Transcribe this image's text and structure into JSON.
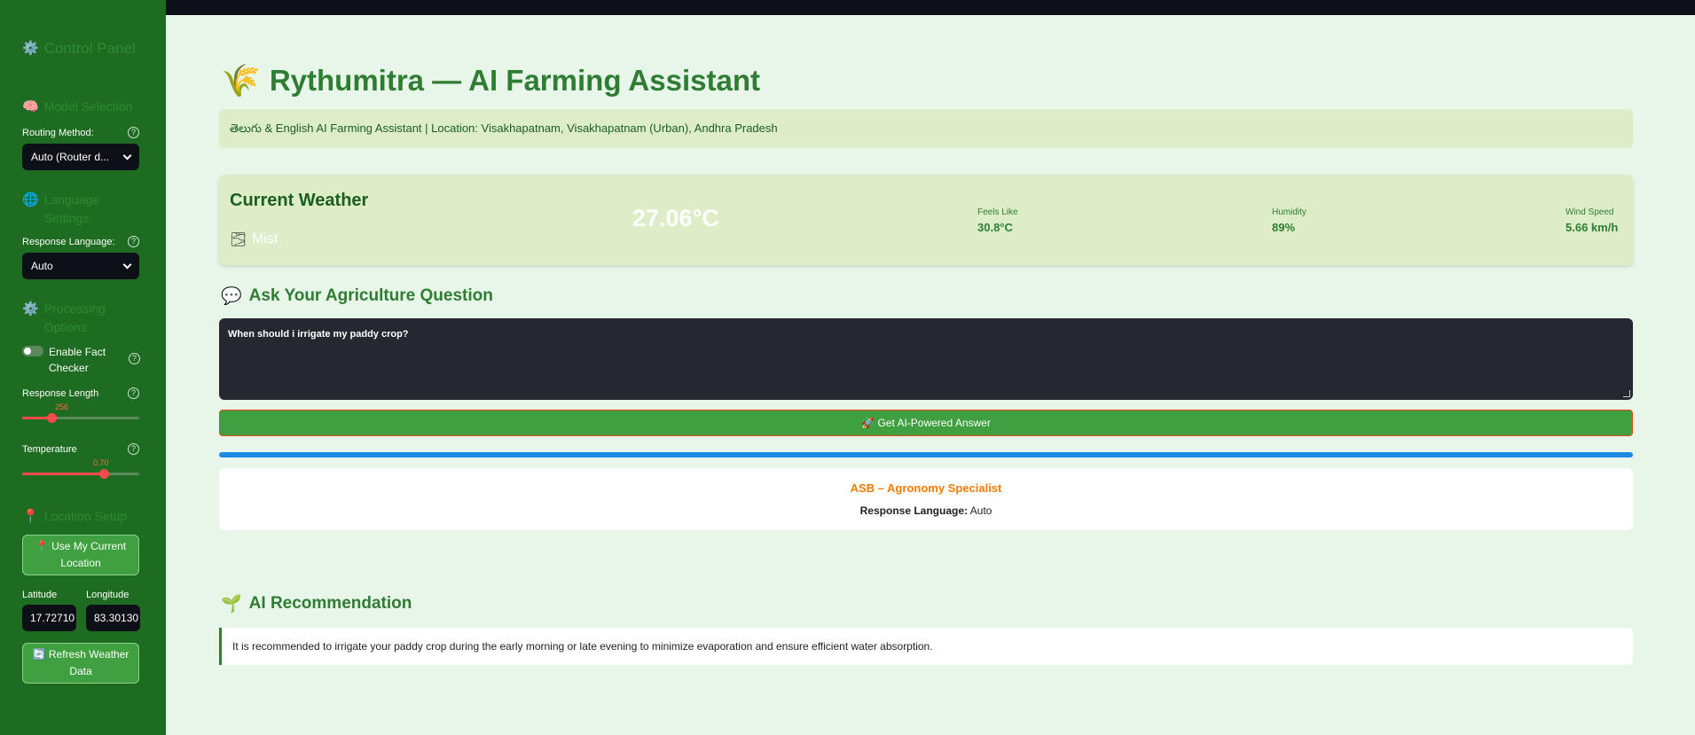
{
  "sidebar": {
    "control_panel": {
      "icon": "⚙️",
      "title": "Control Panel"
    },
    "model_selection": {
      "icon": "🧠",
      "title": "Model Selection"
    },
    "routing_method": {
      "label": "Routing Method:",
      "value": "Auto (Router d..."
    },
    "language_settings": {
      "icon": "🌐",
      "title": "Language Settings"
    },
    "response_language": {
      "label": "Response Language:",
      "value": "Auto"
    },
    "processing_options": {
      "icon": "⚙️",
      "title": "Processing Options"
    },
    "fact_checker": {
      "label": "Enable Fact Checker",
      "enabled": false
    },
    "response_length": {
      "label": "Response Length",
      "value": "256",
      "min": 0,
      "max": 1024
    },
    "temperature": {
      "label": "Temperature",
      "value": "0.70",
      "min": 0,
      "max": 1
    },
    "location_setup": {
      "icon": "📍",
      "title": "Location Setup"
    },
    "use_location_button": {
      "icon": "📍",
      "label": "Use My Current Location"
    },
    "latitude": {
      "label": "Latitude",
      "value": "17.72710"
    },
    "longitude": {
      "label": "Longitude",
      "value": "83.30130"
    },
    "refresh_button": {
      "icon": "🔄",
      "label": "Refresh Weather Data"
    }
  },
  "main": {
    "title_icon": "🌾",
    "title": "Rythumitra — AI Farming Assistant",
    "subtitle": "తెలుగు & English AI Farming Assistant | Location: Visakhapatnam, Visakhapatnam (Urban), Andhra Pradesh",
    "weather": {
      "title": "Current Weather",
      "condition_icon": "🌫",
      "condition": "Mist",
      "temperature": "27.06°C",
      "feels_like": {
        "label": "Feels Like",
        "value": "30.8°C"
      },
      "humidity": {
        "label": "Humidity",
        "value": "89%"
      },
      "wind_speed": {
        "label": "Wind Speed",
        "value": "5.66 km/h"
      }
    },
    "ask": {
      "icon": "💬",
      "title": "Ask Your Agriculture Question",
      "question": "When should i irrigate my paddy crop?",
      "button_icon": "🚀",
      "button_label": "Get AI-Powered Answer"
    },
    "result": {
      "specialist": "ASB – Agronomy Specialist",
      "lang_label": "Response Language:",
      "lang_value": "Auto"
    },
    "recommendation": {
      "icon": "🌱",
      "title": "AI Recommendation",
      "text": "It is recommended to irrigate your paddy crop during the early morning or late evening to minimize evaporation and ensure efficient water absorption."
    }
  },
  "colors": {
    "sidebar_bg": "#1e6b22",
    "main_bg": "#e8f5e9",
    "accent_green": "#2e7d32",
    "button_green": "#3ea03f",
    "slider_red": "#ff4b4b",
    "specialist_orange": "#f57c00",
    "progress_blue": "#1e88e5"
  }
}
